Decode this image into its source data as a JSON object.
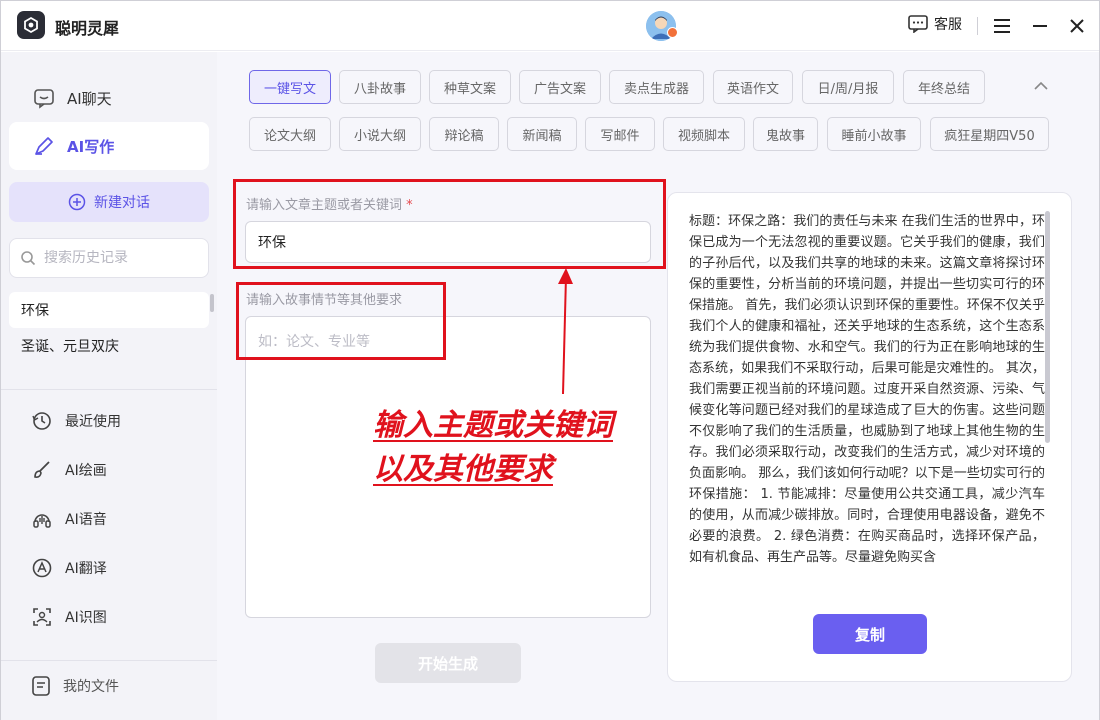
{
  "app": {
    "title": "聪明灵犀"
  },
  "titlebar": {
    "service_label": "客服"
  },
  "sidebar": {
    "nav": [
      {
        "label": "AI聊天",
        "icon": "chat-icon"
      },
      {
        "label": "AI写作",
        "icon": "pen-icon",
        "active": true
      }
    ],
    "new_chat_label": "新建对话",
    "search_placeholder": "搜索历史记录",
    "history": [
      "环保",
      "圣诞、元旦双庆"
    ],
    "tools": [
      {
        "label": "最近使用",
        "icon": "history-icon"
      },
      {
        "label": "AI绘画",
        "icon": "paint-brush-icon"
      },
      {
        "label": "AI语音",
        "icon": "voice-icon"
      },
      {
        "label": "AI翻译",
        "icon": "translate-icon"
      },
      {
        "label": "AI识图",
        "icon": "image-scan-icon"
      }
    ],
    "files_label": "我的文件"
  },
  "tabs": [
    [
      "一键写文",
      "八卦故事",
      "种草文案",
      "广告文案",
      "卖点生成器",
      "英语作文",
      "日/周/月报",
      "年终总结"
    ],
    [
      "论文大纲",
      "小说大纲",
      "辩论稿",
      "新闻稿",
      "写邮件",
      "视频脚本",
      "鬼故事",
      "睡前小故事",
      "疯狂星期四V50"
    ]
  ],
  "active_tab": "一键写文",
  "form": {
    "topic_label": "请输入文章主题或者关键词",
    "topic_required_mark": "*",
    "topic_value": "环保",
    "requirements_label": "请输入故事情节等其他要求",
    "requirements_placeholder": "如：论文、专业等",
    "generate_label": "开始生成"
  },
  "annotation": {
    "line1": "输入主题或关键词",
    "line2": "以及其他要求",
    "color": "#e0121d"
  },
  "output": {
    "text": "标题：环保之路：我们的责任与未来 在我们生活的世界中，环保已成为一个无法忽视的重要议题。它关乎我们的健康，我们的子孙后代，以及我们共享的地球的未来。这篇文章将探讨环保的重要性，分析当前的环境问题，并提出一些切实可行的环保措施。 首先，我们必须认识到环保的重要性。环保不仅关乎我们个人的健康和福祉，还关乎地球的生态系统，这个生态系统为我们提供食物、水和空气。我们的行为正在影响地球的生态系统，如果我们不采取行动，后果可能是灾难性的。 其次，我们需要正视当前的环境问题。过度开采自然资源、污染、气候变化等问题已经对我们的星球造成了巨大的伤害。这些问题不仅影响了我们的生活质量，也威胁到了地球上其他生物的生存。我们必须采取行动，改变我们的生活方式，减少对环境的负面影响。 那么，我们该如何行动呢？以下是一些切实可行的环保措施： 1. 节能减排：尽量使用公共交通工具，减少汽车的使用，从而减少碳排放。同时，合理使用电器设备，避免不必要的浪费。 2. 绿色消费：在购买商品时，选择环保产品，如有机食品、再生产品等。尽量避免购买含",
    "copy_label": "复制"
  },
  "colors": {
    "accent": "#5b53e6",
    "annotation": "#e0121d",
    "copy_button": "#6a5ff0"
  }
}
